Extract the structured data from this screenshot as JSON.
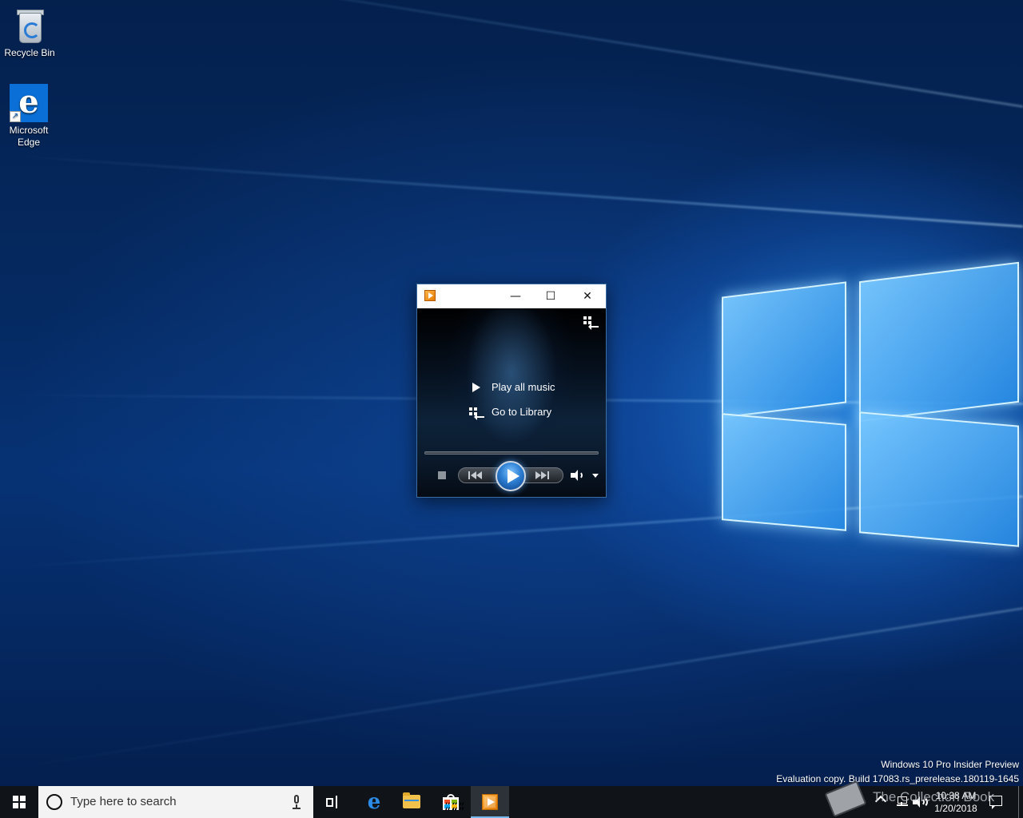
{
  "desktop": {
    "icons": [
      {
        "label": "Recycle Bin",
        "icon": "recycle-bin-icon"
      },
      {
        "label": "Microsoft\nEdge",
        "icon": "edge-icon"
      }
    ],
    "watermark": {
      "line1": "Windows 10 Pro Insider Preview",
      "line2": "Evaluation copy. Build 17083.rs_prerelease.180119-1645"
    },
    "accent": "#0a6fd6"
  },
  "wmp": {
    "title": "",
    "controls": {
      "minimize": "—",
      "maximize": "☐",
      "close": "✕"
    },
    "menu": {
      "play_all": "Play all music",
      "go_to_library": "Go to Library"
    },
    "seek_progress": 0.0
  },
  "taskbar": {
    "search_placeholder": "Type here to search",
    "apps": [
      "task-view",
      "edge",
      "file-explorer",
      "store",
      "windows-media-player"
    ],
    "active_app": "windows-media-player",
    "clock": {
      "time": "10:38 AM",
      "date": "1/20/2018"
    }
  },
  "overlay": {
    "text": "The Collection Book"
  }
}
